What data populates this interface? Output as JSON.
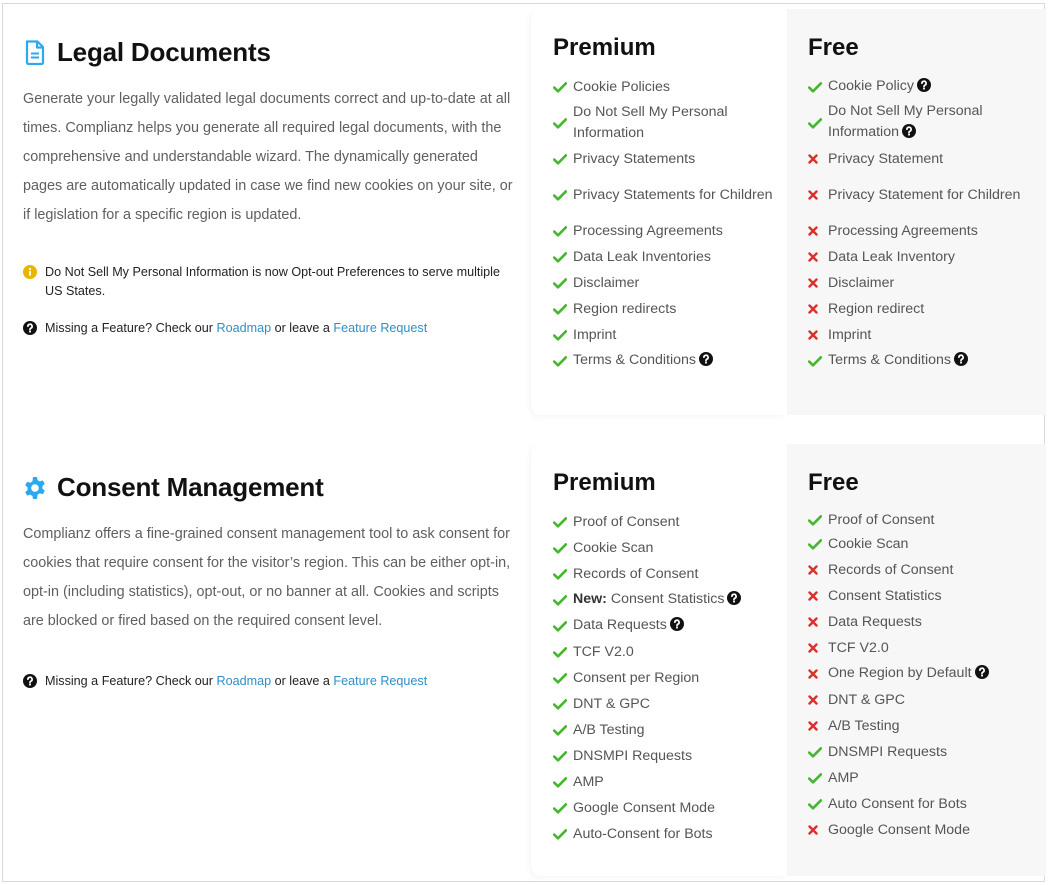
{
  "colors": {
    "accent_blue": "#2aa9f0",
    "check_green": "#45b72f",
    "cross_red": "#d9312b",
    "info_yellow": "#e9b500",
    "link_blue": "#2e8fc7"
  },
  "legal": {
    "icon": "document-icon",
    "title": "Legal Documents",
    "description": "Generate your legally validated legal documents correct and up-to-date at all times. Complianz helps you generate all required legal documents, with the comprehensive and understandable wizard. The dynamically generated pages are automatically updated in case we find new cookies on your site, or if legislation for a specific region is updated.",
    "info_note": "Do Not Sell My Personal Information is now Opt-out Preferences to serve multiple US States.",
    "missing": {
      "prefix": "Missing a Feature? Check our ",
      "roadmap": "Roadmap",
      "middle": " or leave a ",
      "request": "Feature Request"
    },
    "premium": {
      "heading": "Premium",
      "items": [
        {
          "label": "Cookie Policies",
          "included": true,
          "help": false
        },
        {
          "label": "Do Not Sell My Personal Information",
          "included": true,
          "help": false
        },
        {
          "label": "Privacy Statements",
          "included": true,
          "help": false
        },
        {
          "label": "Privacy Statements for Children",
          "included": true,
          "help": false
        },
        {
          "label": "Processing Agreements",
          "included": true,
          "help": false
        },
        {
          "label": "Data Leak Inventories",
          "included": true,
          "help": false
        },
        {
          "label": "Disclaimer",
          "included": true,
          "help": false
        },
        {
          "label": "Region redirects",
          "included": true,
          "help": false
        },
        {
          "label": "Imprint",
          "included": true,
          "help": false
        },
        {
          "label": "Terms & Conditions",
          "included": true,
          "help": true
        }
      ]
    },
    "free": {
      "heading": "Free",
      "items": [
        {
          "label": "Cookie Policy",
          "included": true,
          "help": true
        },
        {
          "label": "Do Not Sell My Personal Information",
          "included": true,
          "help": true
        },
        {
          "label": "Privacy Statement",
          "included": false,
          "help": false
        },
        {
          "label": "Privacy Statement for Children",
          "included": false,
          "help": false
        },
        {
          "label": "Processing Agreements",
          "included": false,
          "help": false
        },
        {
          "label": "Data Leak Inventory",
          "included": false,
          "help": false
        },
        {
          "label": "Disclaimer",
          "included": false,
          "help": false
        },
        {
          "label": "Region redirect",
          "included": false,
          "help": false
        },
        {
          "label": "Imprint",
          "included": false,
          "help": false
        },
        {
          "label": "Terms & Conditions",
          "included": true,
          "help": true
        }
      ]
    }
  },
  "consent": {
    "icon": "gear-icon",
    "title": "Consent Management",
    "description": "Complianz offers a fine-grained consent management tool to ask consent for cookies that require consent for the visitor’s region. This can be either opt-in, opt-in (including statistics), opt-out, or no banner at all. Cookies and scripts are blocked or fired based on the required consent level.",
    "missing": {
      "prefix": "Missing a Feature? Check our ",
      "roadmap": "Roadmap",
      "middle": " or leave a ",
      "request": "Feature Request"
    },
    "premium": {
      "heading": "Premium",
      "items": [
        {
          "label": "Proof of Consent",
          "included": true,
          "help": false
        },
        {
          "label": "Cookie Scan",
          "included": true,
          "help": false
        },
        {
          "label": "Records of Consent",
          "included": true,
          "help": false
        },
        {
          "label": "Consent Statistics",
          "prefix": "New:",
          "included": true,
          "help": true
        },
        {
          "label": "Data Requests",
          "included": true,
          "help": true
        },
        {
          "label": "TCF V2.0",
          "included": true,
          "help": false
        },
        {
          "label": "Consent per Region",
          "included": true,
          "help": false
        },
        {
          "label": "DNT & GPC",
          "included": true,
          "help": false
        },
        {
          "label": "A/B Testing",
          "included": true,
          "help": false
        },
        {
          "label": "DNSMPI Requests",
          "included": true,
          "help": false
        },
        {
          "label": "AMP",
          "included": true,
          "help": false
        },
        {
          "label": "Google Consent Mode",
          "included": true,
          "help": false
        },
        {
          "label": "Auto-Consent for Bots",
          "included": true,
          "help": false
        }
      ]
    },
    "free": {
      "heading": "Free",
      "items": [
        {
          "label": "Proof of Consent",
          "included": true,
          "help": false
        },
        {
          "label": "Cookie Scan",
          "included": true,
          "help": false
        },
        {
          "label": "Records of Consent",
          "included": false,
          "help": false
        },
        {
          "label": "Consent Statistics",
          "included": false,
          "help": false
        },
        {
          "label": "Data Requests",
          "included": false,
          "help": false
        },
        {
          "label": "TCF V2.0",
          "included": false,
          "help": false
        },
        {
          "label": "One Region by Default",
          "included": false,
          "help": true
        },
        {
          "label": "DNT & GPC",
          "included": false,
          "help": false
        },
        {
          "label": "A/B Testing",
          "included": false,
          "help": false
        },
        {
          "label": "DNSMPI Requests",
          "included": true,
          "help": false
        },
        {
          "label": "AMP",
          "included": true,
          "help": false
        },
        {
          "label": "Auto Consent for Bots",
          "included": true,
          "help": false
        },
        {
          "label": "Google Consent Mode",
          "included": false,
          "help": false
        }
      ]
    }
  }
}
